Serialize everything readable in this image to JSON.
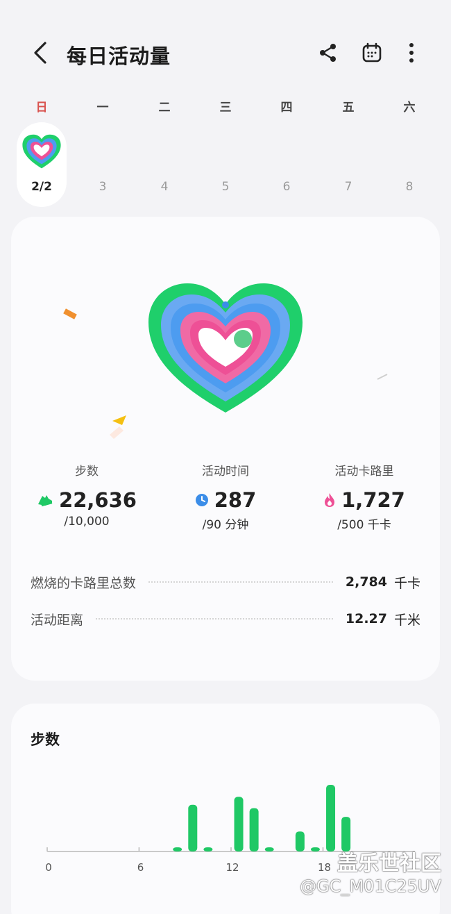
{
  "header": {
    "title": "每日活动量",
    "back_icon": "chevron-left-icon",
    "share_icon": "share-icon",
    "calendar_icon": "calendar-icon",
    "more_icon": "more-vertical-icon"
  },
  "week": {
    "days": [
      "日",
      "一",
      "二",
      "三",
      "四",
      "五",
      "六"
    ],
    "dates": [
      "2/2",
      "3",
      "4",
      "5",
      "6",
      "7",
      "8"
    ],
    "selected_index": 0
  },
  "colors": {
    "ring_outer": "#1fcf6b",
    "ring_middle": "#4d9cf0",
    "ring_inner": "#ee5096",
    "accent_red": "#d9534f",
    "bar_green": "#1fc865"
  },
  "stats": [
    {
      "label": "步数",
      "value": "22,636",
      "goal": "/10,000",
      "icon": "shoe-icon"
    },
    {
      "label": "活动时间",
      "value": "287",
      "goal": "/90 分钟",
      "icon": "clock-icon"
    },
    {
      "label": "活动卡路里",
      "value": "1,727",
      "goal": "/500 千卡",
      "icon": "flame-icon"
    }
  ],
  "details": [
    {
      "label": "燃烧的卡路里总数",
      "value": "2,784",
      "unit": "千卡"
    },
    {
      "label": "活动距离",
      "value": "12.27",
      "unit": "千米"
    }
  ],
  "steps_chart": {
    "title": "步数"
  },
  "chart_data": {
    "type": "bar",
    "title": "步数",
    "x_ticks": [
      "0",
      "6",
      "12",
      "18"
    ],
    "x_tick_positions": [
      0,
      6,
      12,
      18
    ],
    "bars": [
      {
        "hour": 8,
        "value": 0.06
      },
      {
        "hour": 9,
        "value": 0.7
      },
      {
        "hour": 10,
        "value": 0.06
      },
      {
        "hour": 12,
        "value": 0.82
      },
      {
        "hour": 13,
        "value": 0.65
      },
      {
        "hour": 14,
        "value": 0.06
      },
      {
        "hour": 16,
        "value": 0.3
      },
      {
        "hour": 17,
        "value": 0.06
      },
      {
        "hour": 18,
        "value": 1.0
      },
      {
        "hour": 19,
        "value": 0.52
      }
    ],
    "grid": false
  },
  "watermark": {
    "line1": "盖乐世社区",
    "line2": "@GC_M01C25UV"
  }
}
